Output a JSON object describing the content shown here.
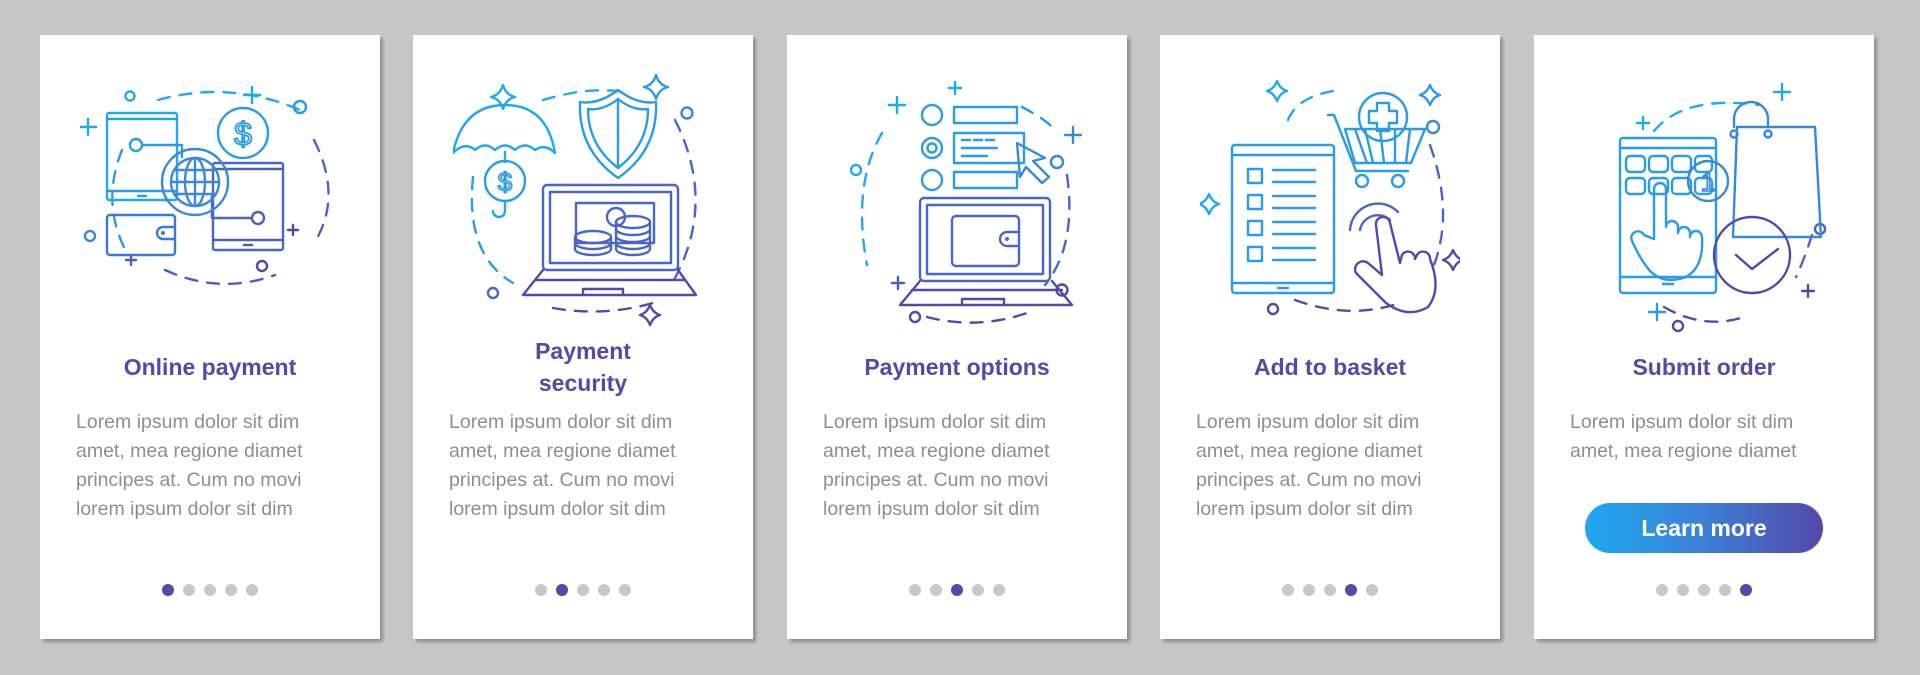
{
  "colors": {
    "background": "#c6c6c6",
    "card": "#ffffff",
    "title": "#5548a8",
    "body_text": "#8e8e8e",
    "dot_inactive": "#c8c8c8",
    "dot_active": "#5548a8",
    "gradient_start": "#1ea9f0",
    "gradient_end": "#5548a8"
  },
  "cards": [
    {
      "title": "Online payment",
      "illustration": [
        "smartphone-icon",
        "tablet-icon",
        "globe-icon",
        "dollar-coin-icon",
        "wallet-icon"
      ],
      "body": "Lorem ipsum dolor sit dim\namet, mea regione diamet\nprincipes at. Cum no movi\nlorem ipsum dolor sit dim",
      "page_index": 1,
      "page_count": 5
    },
    {
      "title": "Payment\nsecurity",
      "illustration": [
        "umbrella-icon",
        "dollar-coin-icon",
        "shield-icon",
        "laptop-icon",
        "coins-icon"
      ],
      "body": "Lorem ipsum dolor sit dim\namet, mea regione diamet\nprincipes at. Cum no movi\nlorem ipsum dolor sit dim",
      "page_index": 2,
      "page_count": 5
    },
    {
      "title": "Payment options",
      "illustration": [
        "radio-list-icon",
        "cursor-icon",
        "laptop-icon",
        "wallet-icon"
      ],
      "body": "Lorem ipsum dolor sit dim\namet, mea regione diamet\nprincipes at. Cum no movi\nlorem ipsum dolor sit dim",
      "page_index": 3,
      "page_count": 5
    },
    {
      "title": "Add to basket",
      "illustration": [
        "tablet-checklist-icon",
        "shopping-cart-add-icon",
        "tap-hand-icon"
      ],
      "body": "Lorem ipsum dolor sit dim\namet, mea regione diamet\nprincipes at. Cum no movi\nlorem ipsum dolor sit dim",
      "page_index": 4,
      "page_count": 5
    },
    {
      "title": "Submit order",
      "illustration": [
        "tablet-keypad-icon",
        "tap-hand-icon",
        "shopping-bag-icon",
        "badge-1-icon",
        "checkmark-circle-icon"
      ],
      "body": "Lorem ipsum dolor sit dim\namet, mea regione diamet",
      "button_label": "Learn more",
      "page_index": 5,
      "page_count": 5
    }
  ]
}
